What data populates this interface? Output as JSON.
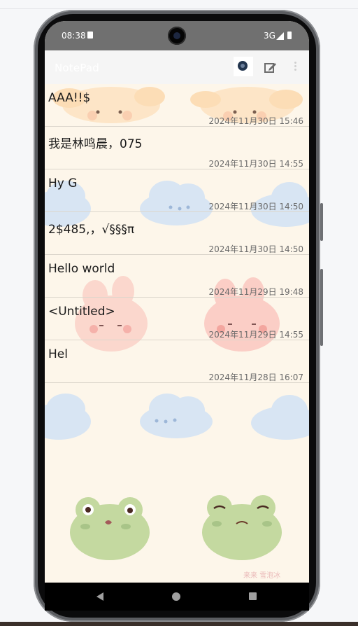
{
  "status_bar": {
    "time": "08:38",
    "network": "3G"
  },
  "app_bar": {
    "title": "NotePad",
    "icons": [
      "search-icon",
      "edit-icon",
      "more-vert-icon"
    ]
  },
  "notes": [
    {
      "title": "AAA!!$",
      "date": "2024年11月30日 15:46"
    },
    {
      "title": "我是林鸣晨，075",
      "date": "2024年11月30日 14:55"
    },
    {
      "title": "Hy  G",
      "date": "2024年11月30日 14:50"
    },
    {
      "title": "2$485,，√§§§π",
      "date": "2024年11月30日 14:50"
    },
    {
      "title": "Hello world",
      "date": "2024年11月29日 19:48"
    },
    {
      "title": "<Untitled>",
      "date": "2024年11月29日 14:55"
    },
    {
      "title": "Hel",
      "date": "2024年11月28日 16:07"
    }
  ],
  "wallpaper_signature": "来来 雪泡冰",
  "nav_bar": {
    "icons": [
      "back-icon",
      "home-icon",
      "recents-icon"
    ]
  },
  "colors": {
    "background": "#fdf6ea",
    "action_bar": "#f5f5f5",
    "status_bar": "#707070"
  }
}
